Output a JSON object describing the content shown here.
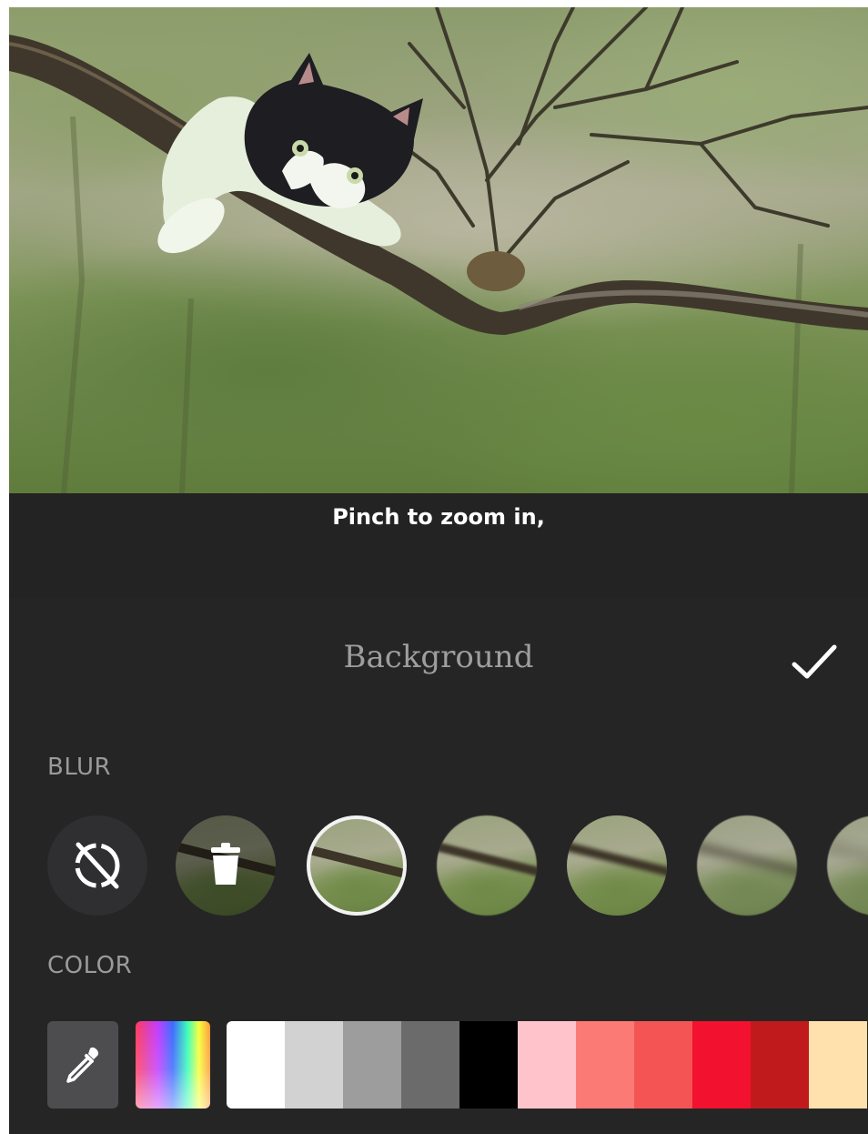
{
  "hint_text": "Pinch to zoom in,",
  "panel": {
    "title": "Background",
    "confirm_icon": "check-icon",
    "blur_label": "BLUR",
    "color_label": "COLOR"
  },
  "blur_options": [
    {
      "name": "no-blur",
      "icon": "no-blur-icon"
    },
    {
      "name": "remove",
      "icon": "trash-icon"
    },
    {
      "name": "blur-level-1",
      "selected": true
    },
    {
      "name": "blur-level-2"
    },
    {
      "name": "blur-level-3"
    },
    {
      "name": "blur-level-4"
    },
    {
      "name": "blur-level-5"
    }
  ],
  "color_tools": {
    "eyedropper_icon": "eyedropper-icon",
    "picker": "rainbow-color-picker"
  },
  "swatches": [
    "#ffffff",
    "#d2d2d2",
    "#9d9d9d",
    "#6b6b6b",
    "#000000",
    "#ffc3cc",
    "#fb7a75",
    "#f55454",
    "#f2112e",
    "#c01a1c",
    "#ffe1ad"
  ]
}
